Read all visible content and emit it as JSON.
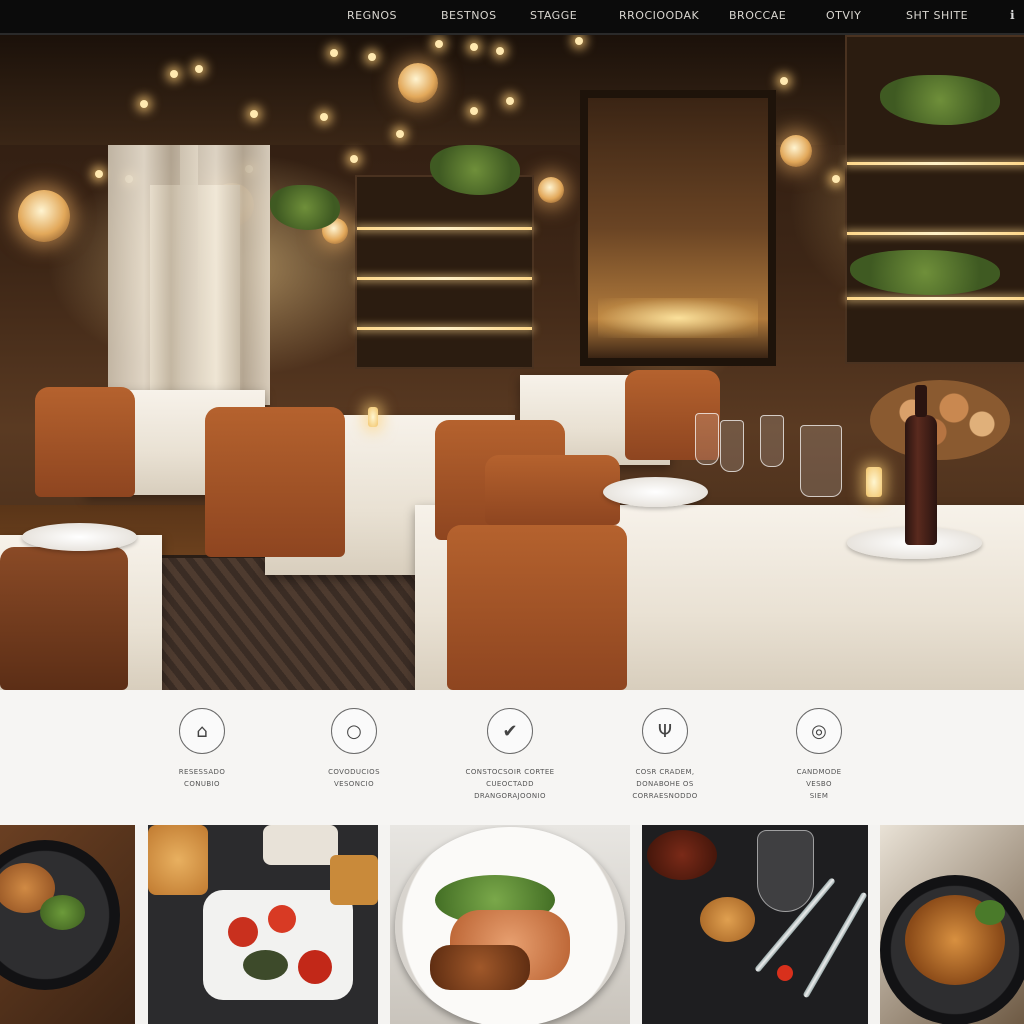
{
  "nav": {
    "items": [
      "REGNOS",
      "BESTNOS",
      "STAGGE",
      "RROCIOODAK",
      "BROCCAE",
      "OTVIY",
      "SHT SHITE"
    ],
    "more_icon": "info-icon"
  },
  "features": [
    {
      "icon": "cloche-icon",
      "lines": [
        "RESESSADO",
        "CONUBIO"
      ]
    },
    {
      "icon": "lock-icon",
      "lines": [
        "COVODUCIOS",
        "VESONCIO"
      ]
    },
    {
      "icon": "checkmark-icon",
      "lines": [
        "CONSTOCSOIR CORTEE",
        "CUEOCTADD",
        "DRANGORAJOONIO"
      ]
    },
    {
      "icon": "tree-icon",
      "lines": [
        "COSR CRADEM,",
        "DONABOHE OS",
        "CORRAESNODDO"
      ]
    },
    {
      "icon": "dish-icon",
      "lines": [
        "CANDMODE",
        "VESBO",
        "SIEM"
      ]
    }
  ],
  "gallery": [
    "burger-plate",
    "tomato-salad",
    "salmon-roses",
    "dessert-cutlery",
    "spaghetti-plate"
  ]
}
